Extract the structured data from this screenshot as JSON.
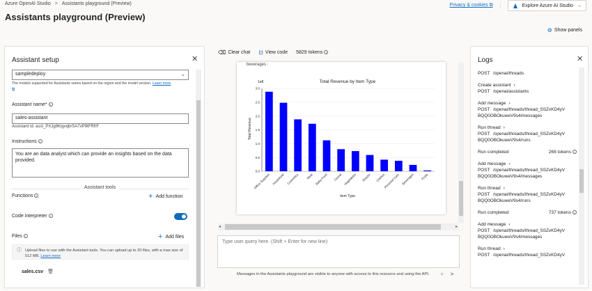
{
  "header": {
    "breadcrumb_root": "Azure OpenAI Studio",
    "breadcrumb_current": "Assistants playground (Preview)",
    "privacy_link": "Privacy & cookies",
    "explore_button": "Explore Azure AI Studio",
    "page_title": "Assistants playground (Preview)",
    "show_panels": "Show panels"
  },
  "setup": {
    "title": "Assistant setup",
    "deployment_value": "sampledeploy",
    "deployment_note": "The models supported for Assistants varies based on the region and the model version.",
    "learn_more": "Learn more",
    "name_label": "Assistant name*",
    "name_value": "sales-assistant",
    "assistant_id": "Assistant id: asst_PXJg9KigvqbrSA7vP9tFRfrF",
    "instructions_label": "Instructions",
    "instructions_value": "You are an data analyst which can provide an insights based on the data provided.",
    "tools_header": "Assistant tools",
    "functions_label": "Functions",
    "add_function": "Add function",
    "code_interpreter_label": "Code interpreter",
    "code_interpreter_on": true,
    "files_label": "Files",
    "add_files": "Add files",
    "upload_note": "Upload files to use with the Assistant tools. You can upload up to 20 files, with a max size of 512 MB.",
    "upload_learn_more": "Learn more",
    "file_name": "sales.csv"
  },
  "chat": {
    "clear_chat": "Clear chat",
    "view_code": "View code",
    "tokens": "5829 tokens",
    "partial_text": "beverages :",
    "query_placeholder": "Type user query here. (Shift + Enter for new line)",
    "footer_note": "Messages in the Assistants playground are visible to anyone with access to this resource and using the API."
  },
  "chart_data": {
    "type": "bar",
    "title": "Total Revenue by Item Type",
    "xlabel": "Item Type",
    "ylabel": "Total Revenue",
    "scale_label": "1e8",
    "ylim": [
      0,
      3.0
    ],
    "yticks": [
      "0.0",
      "0.5",
      "1.0",
      "1.5",
      "2.0",
      "2.5",
      "3.0"
    ],
    "categories": [
      "Office Supplies",
      "Household",
      "Cosmetics",
      "Meat",
      "Baby Food",
      "Cereal",
      "Vegetables",
      "Snacks",
      "Clothes",
      "Personal Care",
      "Beverages",
      "Fruits"
    ],
    "values": [
      2.88,
      2.48,
      1.88,
      1.72,
      1.12,
      0.8,
      0.73,
      0.59,
      0.42,
      0.38,
      0.23,
      0.03
    ],
    "bar_color": "#0000ff",
    "grid": true
  },
  "logs": {
    "title": "Logs",
    "entries": [
      {
        "post": "POST",
        "path": "/openai/threads"
      },
      {
        "label": "Create assistant",
        "post": "POST",
        "path": "/openai/assistants"
      },
      {
        "label": "Add message",
        "post": "POST",
        "path": "/openai/threads/thread_SSZvKD4yV",
        "path2": "BQQ0OBOkuweV9s4/messages"
      },
      {
        "label": "Run thread",
        "post": "POST",
        "path": "/openai/threads/thread_SSZvKD4yV",
        "path2": "BQQ0OBOkuweV9s4/runs"
      },
      {
        "label": "Run completed",
        "tokens": "268 tokens"
      },
      {
        "label": "Add message",
        "post": "POST",
        "path": "/openai/threads/thread_SSZvKD4yV",
        "path2": "BQQ0OBOkuweV9s4/messages"
      },
      {
        "label": "Run thread",
        "post": "POST",
        "path": "/openai/threads/thread_SSZvKD4yV",
        "path2": "BQQ0OBOkuweV9s4/runs"
      },
      {
        "label": "Run completed",
        "tokens": "737 tokens"
      },
      {
        "label": "Add message",
        "post": "POST",
        "path": "/openai/threads/thread_SSZvKD4yV",
        "path2": "BQQ0OBOkuweV9s4/messages"
      },
      {
        "label": "Run thread",
        "post": "POST",
        "path": "/openai/threads/thread_SSZvKD4yV"
      }
    ]
  },
  "colors": {
    "accent": "#0f6cbd",
    "bar": "#0000ff"
  }
}
